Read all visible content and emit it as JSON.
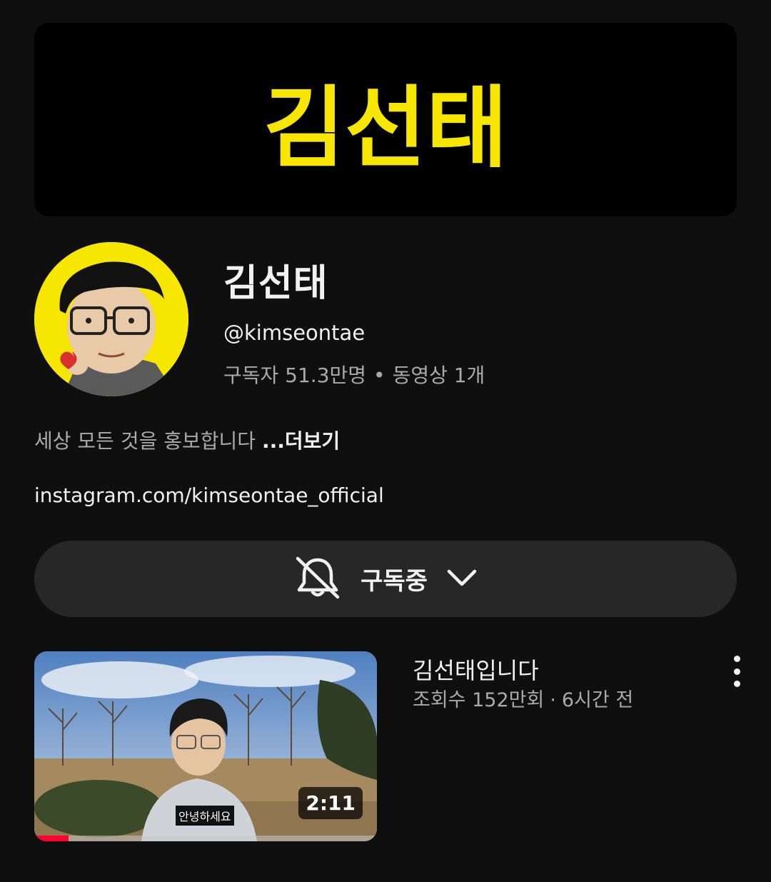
{
  "banner": {
    "logo_text": "김선태",
    "logo_color": "#f6e600"
  },
  "channel": {
    "name": "김선태",
    "handle": "@kimseontae",
    "subscribers": "구독자 51.3만명",
    "separator": "•",
    "videos": "동영상 1개",
    "description": "세상 모든 것을 홍보합니다 ",
    "more_label": "...더보기",
    "link": "instagram.com/kimseontae_official"
  },
  "subscribe": {
    "label": "구독중",
    "bell_icon": "bell-off-icon",
    "chevron_icon": "chevron-down-icon"
  },
  "video": {
    "title": "김선태입니다",
    "views": "조회수 152만회",
    "separator": "·",
    "age": "6시간 전",
    "duration": "2:11",
    "caption": "안녕하세요",
    "progress": 0.1,
    "progress_color": "#ff0033"
  },
  "colors": {
    "background": "#0f0f0f",
    "surface": "#272727",
    "secondary_text": "#aaaaaa",
    "primary_text": "#f1f1f1"
  }
}
